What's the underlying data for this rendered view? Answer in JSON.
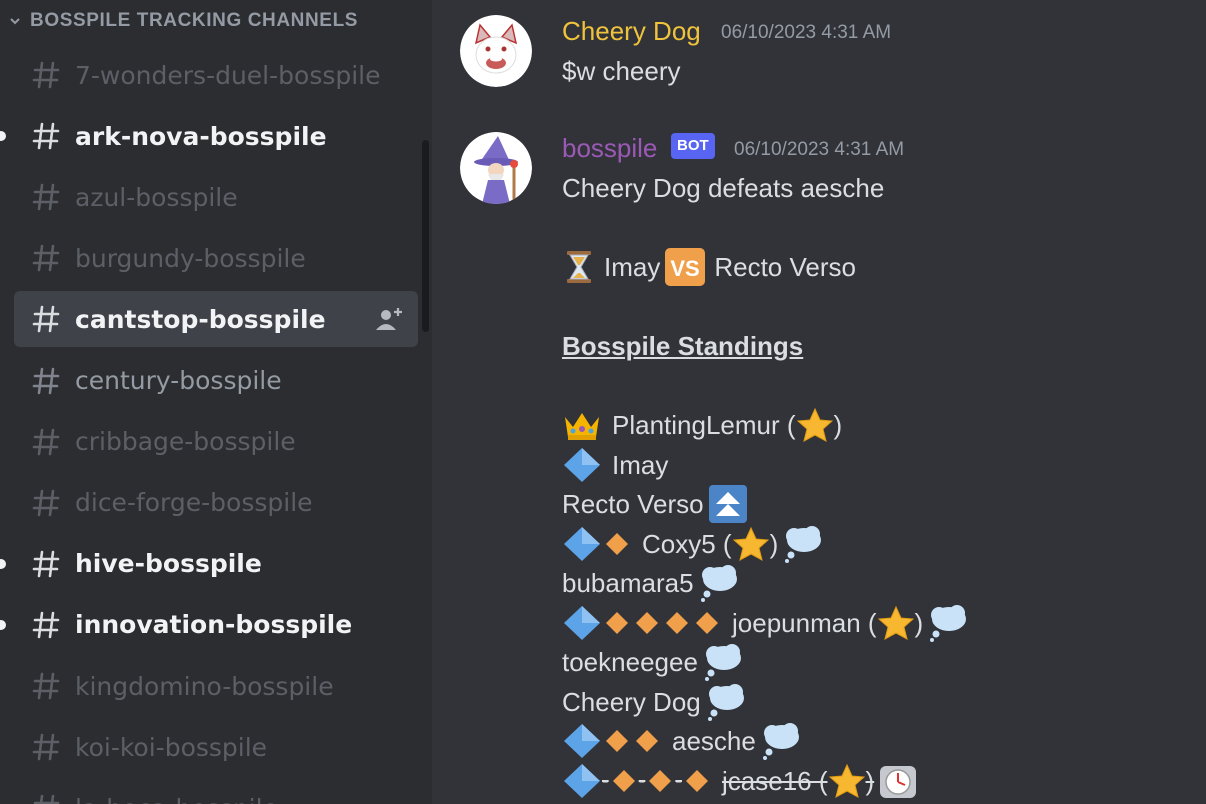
{
  "sidebar": {
    "category": "BOSSPILE TRACKING CHANNELS",
    "channels": [
      {
        "label": "7-wonders-duel-bosspile",
        "state": "muted"
      },
      {
        "label": "ark-nova-bosspile",
        "state": "unread"
      },
      {
        "label": "azul-bosspile",
        "state": "muted"
      },
      {
        "label": "burgundy-bosspile",
        "state": "muted"
      },
      {
        "label": "cantstop-bosspile",
        "state": "selected"
      },
      {
        "label": "century-bosspile",
        "state": "normal"
      },
      {
        "label": "cribbage-bosspile",
        "state": "muted"
      },
      {
        "label": "dice-forge-bosspile",
        "state": "muted"
      },
      {
        "label": "hive-bosspile",
        "state": "unread"
      },
      {
        "label": "innovation-bosspile",
        "state": "unread"
      },
      {
        "label": "kingdomino-bosspile",
        "state": "muted"
      },
      {
        "label": "koi-koi-bosspile",
        "state": "muted"
      },
      {
        "label": "la-boca-bosspile",
        "state": "muted"
      }
    ]
  },
  "messages": [
    {
      "author": "Cheery Dog",
      "author_color": "#f0c33c",
      "timestamp": "06/10/2023 4:31 AM",
      "text": "$w cheery"
    },
    {
      "author": "bosspile",
      "author_color": "#9b59b6",
      "badge": "BOT",
      "timestamp": "06/10/2023 4:31 AM",
      "line1": "Cheery Dog defeats aesche",
      "match": {
        "left": "Imay",
        "vs_icon": "VS",
        "right": "Recto Verso"
      },
      "standings_title": "Bosspile Standings",
      "standings": [
        {
          "name": "PlantingLemur (",
          "close": ")"
        },
        {
          "name": "Imay"
        },
        {
          "name": "Recto Verso"
        },
        {
          "name": "Coxy5 (",
          "close": ")"
        },
        {
          "name": "bubamara5"
        },
        {
          "name": "joepunman (",
          "close": ")"
        },
        {
          "name": "toekneegee"
        },
        {
          "name": "Cheery Dog"
        },
        {
          "name": "aesche"
        },
        {
          "name": "jcase16 (",
          "close": ")",
          "struck_sep": "-"
        }
      ]
    }
  ],
  "colors": {
    "sidebar_bg": "#2b2d31",
    "chat_bg": "#313338",
    "selected_bg": "#404249",
    "bot_badge": "#5865f2"
  }
}
